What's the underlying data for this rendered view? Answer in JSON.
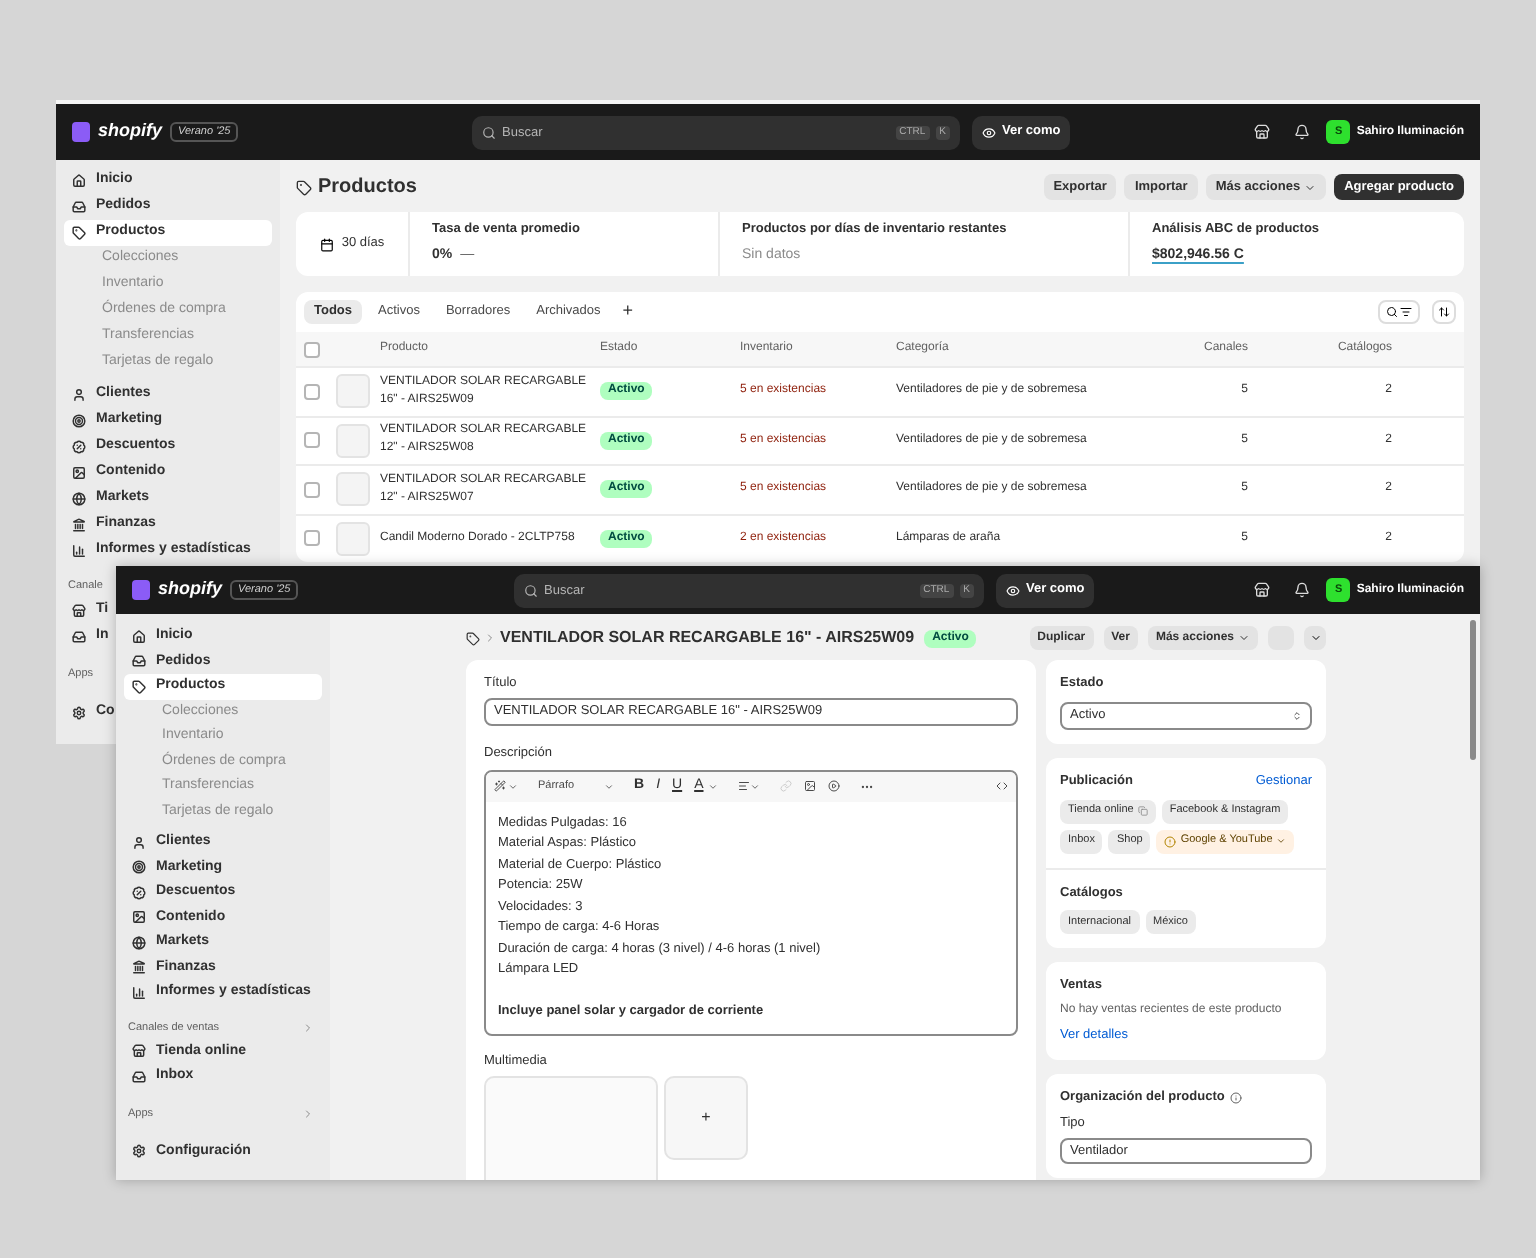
{
  "back_window": {
    "top_bar": {
      "logo": "shopify",
      "edition": "Verano '25",
      "search_placeholder": "Buscar",
      "shortcut": [
        "CTRL",
        "K"
      ],
      "view_as": "Ver como",
      "avatar": "S",
      "store": "Sahiro Iluminación"
    },
    "sidebar": {
      "nav": [
        {
          "label": "Inicio",
          "selected": false
        },
        {
          "label": "Pedidos",
          "selected": false
        },
        {
          "label": "Productos",
          "selected": true,
          "children": [
            {
              "label": "Colecciones",
              "selected": false
            },
            {
              "label": "Inventario",
              "selected": false
            },
            {
              "label": "Órdenes de compra",
              "selected": false
            },
            {
              "label": "Transferencias",
              "selected": false
            },
            {
              "label": "Tarjetas de regalo",
              "selected": false
            }
          ]
        },
        {
          "label": "Clientes",
          "selected": false
        },
        {
          "label": "Marketing",
          "selected": false
        },
        {
          "label": "Descuentos",
          "selected": false
        },
        {
          "label": "Contenido",
          "selected": false
        },
        {
          "label": "Markets",
          "selected": false
        },
        {
          "label": "Finanzas",
          "selected": false
        },
        {
          "label": "Informes y estadísticas",
          "selected": false
        }
      ],
      "channels_label": "Canale",
      "channels": [
        {
          "label": "Ti",
          "selected": false
        },
        {
          "label": "In",
          "selected": false
        }
      ],
      "apps_label": "Apps",
      "settings": "Co"
    },
    "page": {
      "title": "Productos",
      "actions": [
        {
          "label": "Exportar",
          "kind": "secondary"
        },
        {
          "label": "Importar",
          "kind": "secondary"
        },
        {
          "label": "Más acciones",
          "kind": "menu"
        },
        {
          "label": "Agregar producto",
          "kind": "primary"
        }
      ],
      "stats": {
        "period": "30 días",
        "metrics": [
          {
            "label": "Tasa de venta promedio",
            "value": "0%",
            "trend": "—",
            "kind": "number"
          },
          {
            "label": "Productos por días de inventario restantes",
            "value": "Sin datos",
            "kind": "empty"
          },
          {
            "label": "Análisis ABC de productos",
            "value": "$802,946.56 C",
            "kind": "highlight"
          }
        ]
      },
      "table": {
        "tabs": [
          {
            "label": "Todos",
            "selected": true
          },
          {
            "label": "Activos",
            "selected": false
          },
          {
            "label": "Borradores",
            "selected": false
          },
          {
            "label": "Archivados",
            "selected": false
          }
        ],
        "add_tab": "+",
        "select_all": false,
        "columns": [
          "Producto",
          "Estado",
          "Inventario",
          "Categoría",
          "Canales",
          "Catálogos"
        ],
        "rows": [
          {
            "selected": false,
            "product": "VENTILADOR SOLAR RECARGABLE 16\" - AIRS25W09",
            "status": "Activo",
            "inventory": "5 en existencias",
            "category": "Ventiladores de pie y de sobremesa",
            "channels": "5",
            "catalogs": "2"
          },
          {
            "selected": false,
            "product": "VENTILADOR SOLAR RECARGABLE 12\" - AIRS25W08",
            "status": "Activo",
            "inventory": "5 en existencias",
            "category": "Ventiladores de pie y de sobremesa",
            "channels": "5",
            "catalogs": "2"
          },
          {
            "selected": false,
            "product": "VENTILADOR SOLAR RECARGABLE 12\" - AIRS25W07",
            "status": "Activo",
            "inventory": "5 en existencias",
            "category": "Ventiladores de pie y de sobremesa",
            "channels": "5",
            "catalogs": "2"
          },
          {
            "selected": false,
            "product": "Candil Moderno Dorado - 2CLTP758",
            "status": "Activo",
            "inventory": "2 en existencias",
            "category": "Lámparas de araña",
            "channels": "5",
            "catalogs": "2"
          }
        ]
      }
    }
  },
  "front_window": {
    "top_bar": {
      "logo": "shopify",
      "edition": "Verano '25",
      "search_placeholder": "Buscar",
      "shortcut": [
        "CTRL",
        "K"
      ],
      "view_as": "Ver como",
      "avatar": "S",
      "store": "Sahiro Iluminación"
    },
    "sidebar": {
      "nav": [
        {
          "label": "Inicio",
          "selected": false
        },
        {
          "label": "Pedidos",
          "selected": false
        },
        {
          "label": "Productos",
          "selected": true,
          "children": [
            {
              "label": "Colecciones",
              "selected": false
            },
            {
              "label": "Inventario",
              "selected": false
            },
            {
              "label": "Órdenes de compra",
              "selected": false
            },
            {
              "label": "Transferencias",
              "selected": false
            },
            {
              "label": "Tarjetas de regalo",
              "selected": false
            }
          ]
        },
        {
          "label": "Clientes",
          "selected": false
        },
        {
          "label": "Marketing",
          "selected": false
        },
        {
          "label": "Descuentos",
          "selected": false
        },
        {
          "label": "Contenido",
          "selected": false
        },
        {
          "label": "Markets",
          "selected": false
        },
        {
          "label": "Finanzas",
          "selected": false
        },
        {
          "label": "Informes y estadísticas",
          "selected": false
        }
      ],
      "channels_label": "Canales de ventas",
      "channels": [
        {
          "label": "Tienda online",
          "selected": false
        },
        {
          "label": "Inbox",
          "selected": false
        }
      ],
      "apps_label": "Apps",
      "settings": "Configuración"
    },
    "header": {
      "title": "VENTILADOR SOLAR RECARGABLE 16\" - AIRS25W09",
      "status": "Activo",
      "actions": [
        {
          "label": "Duplicar",
          "kind": "plain"
        },
        {
          "label": "Ver",
          "kind": "plain"
        },
        {
          "label": "Más acciones",
          "kind": "menu"
        }
      ]
    },
    "product_form": {
      "title_label": "Título",
      "title_value": "VENTILADOR SOLAR RECARGABLE 16\" - AIRS25W09",
      "description_label": "Descripción",
      "editor": {
        "block_format": "Párrafo",
        "format_buttons": [
          "B",
          "I",
          "U",
          "A"
        ],
        "paragraphs": [
          {
            "bold": false,
            "lines": [
              "Medidas Pulgadas: 16",
              "Material Aspas: Plástico",
              "Material de Cuerpo: Plástico",
              "Potencia: 25W",
              "Velocidades: 3",
              "Tiempo de carga: 4-6 Horas",
              "Duración de carga: 4 horas (3 nivel) / 4-6 horas (1 nivel)",
              "Lámpara LED"
            ]
          },
          {
            "bold": true,
            "lines": [
              "Incluye panel solar y cargador de corriente"
            ]
          }
        ]
      },
      "media_label": "Multimedia",
      "add_media": "+"
    },
    "status_card": {
      "label": "Estado",
      "value": "Activo"
    },
    "publication": {
      "label": "Publicación",
      "manage": "Gestionar",
      "channels": [
        {
          "label": "Tienda online",
          "kind": "linked"
        },
        {
          "label": "Facebook & Instagram",
          "kind": "plain"
        },
        {
          "label": "Inbox",
          "kind": "plain"
        },
        {
          "label": "Shop",
          "kind": "plain"
        },
        {
          "label": "Google & YouTube",
          "kind": "warning"
        }
      ],
      "catalogs_label": "Catálogos",
      "catalogs": [
        "Internacional",
        "México"
      ]
    },
    "sales": {
      "label": "Ventas",
      "message": "No hay ventas recientes de este producto",
      "link": "Ver detalles"
    },
    "organization": {
      "label": "Organización del producto",
      "type_label": "Tipo",
      "type_value": "Ventilador"
    }
  }
}
